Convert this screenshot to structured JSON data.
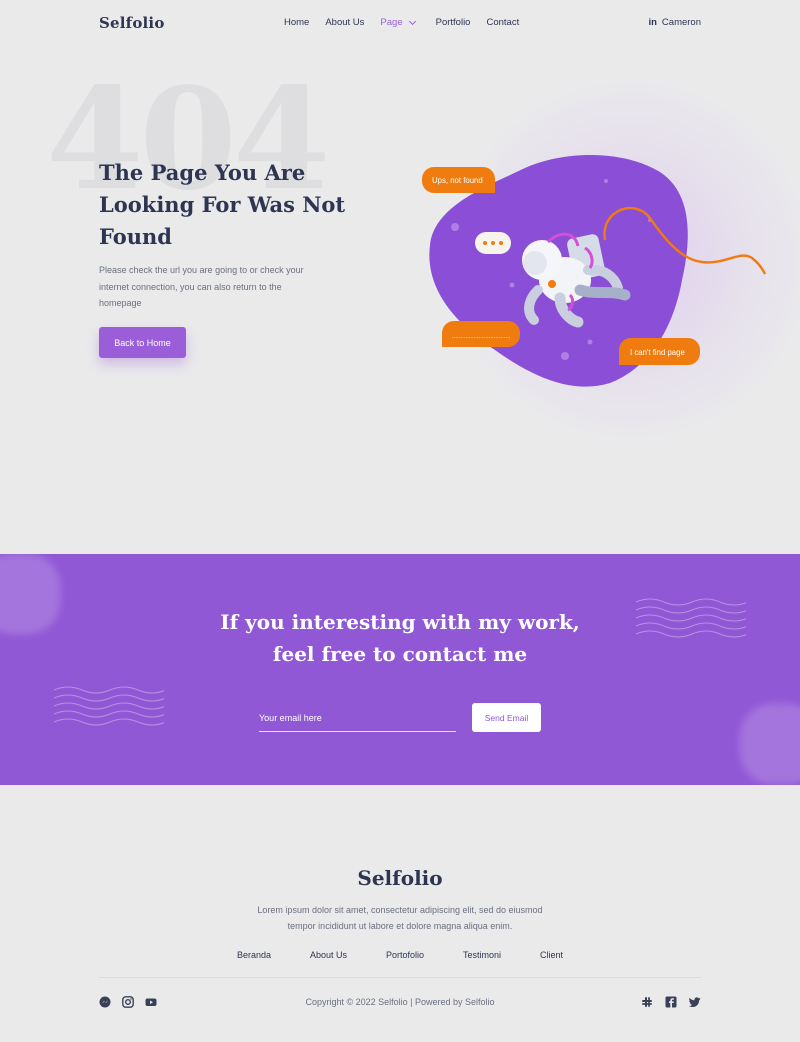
{
  "nav": {
    "logo": "Selfolio",
    "items": [
      "Home",
      "About Us",
      "Page",
      "Portfolio",
      "Contact"
    ],
    "user": "Cameron",
    "user_icon": "linkedin-icon",
    "accent": "#9a5fd8"
  },
  "hero": {
    "bg_number": "404",
    "title": "The Page You Are Looking For Was Not Found",
    "description": "Please check the url you are going to or check your internet connection, you can also return to the homepage",
    "button": "Back to Home",
    "bubbles": {
      "top": "Ups, not found",
      "middle": "...................................",
      "bottom": "I can't find page"
    },
    "colors": {
      "blob": "#8a4fd6",
      "bubble": "#f07c0f"
    }
  },
  "contact": {
    "title_line1": "If you interesting with my work,",
    "title_line2": "feel free to contact me",
    "email_placeholder": "Your email here",
    "send_button": "Send Email",
    "bg": "#9158d6"
  },
  "footer": {
    "logo": "Selfolio",
    "description": "Lorem ipsum dolor sit amet, consectetur adipiscing elit, sed do eiusmod tempor incididunt ut labore et dolore magna aliqua enim.",
    "links": [
      "Beranda",
      "About Us",
      "Portofolio",
      "Testimoni",
      "Client"
    ],
    "copyright": "Copyright © 2022 Selfolio | Powered by Selfolio",
    "social_left": [
      "messenger-icon",
      "instagram-icon",
      "youtube-icon"
    ],
    "social_right": [
      "slack-icon",
      "facebook-icon",
      "twitter-icon"
    ]
  }
}
